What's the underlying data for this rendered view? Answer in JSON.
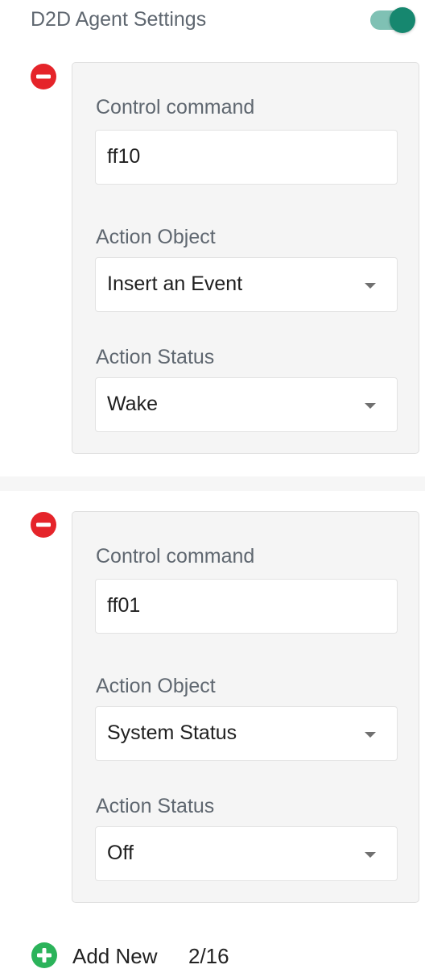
{
  "header": {
    "title": "D2D Agent Settings",
    "toggle_state": "on",
    "toggle_color": "#16876f"
  },
  "entries": [
    {
      "control_command_label": "Control command",
      "control_command_value": "ff10",
      "action_object_label": "Action Object",
      "action_object_value": "Insert an Event",
      "action_status_label": "Action Status",
      "action_status_value": "Wake"
    },
    {
      "control_command_label": "Control command",
      "control_command_value": "ff01",
      "action_object_label": "Action Object",
      "action_object_value": "System Status",
      "action_status_label": "Action Status",
      "action_status_value": "Off"
    }
  ],
  "footer": {
    "add_label": "Add New",
    "count": "2/16"
  },
  "icons": {
    "remove": "minus-circle-icon",
    "add": "plus-circle-icon",
    "dropdown": "caret-down-icon"
  },
  "colors": {
    "remove_red": "#e5242a",
    "add_green": "#2bb35a",
    "label_gray": "#5f6770"
  }
}
